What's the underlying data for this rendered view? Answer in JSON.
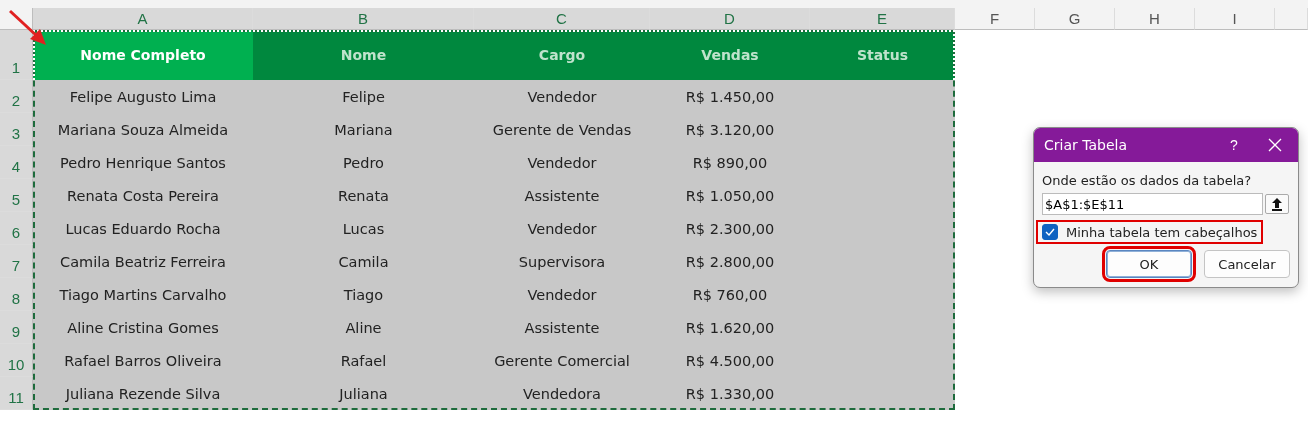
{
  "sheet": {
    "columns": [
      {
        "label": "A",
        "selected": true
      },
      {
        "label": "B",
        "selected": true
      },
      {
        "label": "C",
        "selected": true
      },
      {
        "label": "D",
        "selected": true
      },
      {
        "label": "E",
        "selected": true
      },
      {
        "label": "F",
        "selected": false
      },
      {
        "label": "G",
        "selected": false
      },
      {
        "label": "H",
        "selected": false
      },
      {
        "label": "I",
        "selected": false
      }
    ],
    "row_numbers": [
      {
        "label": "1",
        "selected": true
      },
      {
        "label": "2",
        "selected": true
      },
      {
        "label": "3",
        "selected": true
      },
      {
        "label": "4",
        "selected": true
      },
      {
        "label": "5",
        "selected": true
      },
      {
        "label": "6",
        "selected": true
      },
      {
        "label": "7",
        "selected": true
      },
      {
        "label": "8",
        "selected": true
      },
      {
        "label": "9",
        "selected": true
      },
      {
        "label": "10",
        "selected": true
      },
      {
        "label": "11",
        "selected": true
      }
    ],
    "header": [
      {
        "text": "Nome Completo",
        "selected": true
      },
      {
        "text": "Nome",
        "selected": false
      },
      {
        "text": "Cargo",
        "selected": false
      },
      {
        "text": "Vendas",
        "selected": false
      },
      {
        "text": "Status",
        "selected": false
      }
    ],
    "rows": [
      [
        "Felipe Augusto Lima",
        "Felipe",
        "Vendedor",
        "R$ 1.450,00",
        ""
      ],
      [
        "Mariana Souza Almeida",
        "Mariana",
        "Gerente de Vendas",
        "R$ 3.120,00",
        ""
      ],
      [
        "Pedro Henrique Santos",
        "Pedro",
        "Vendedor",
        "R$ 890,00",
        ""
      ],
      [
        "Renata Costa Pereira",
        "Renata",
        "Assistente",
        "R$ 1.050,00",
        ""
      ],
      [
        "Lucas Eduardo Rocha",
        "Lucas",
        "Vendedor",
        "R$ 2.300,00",
        ""
      ],
      [
        "Camila Beatriz Ferreira",
        "Camila",
        "Supervisora",
        "R$ 2.800,00",
        ""
      ],
      [
        "Tiago Martins Carvalho",
        "Tiago",
        "Vendedor",
        "R$ 760,00",
        ""
      ],
      [
        "Aline Cristina Gomes",
        "Aline",
        "Assistente",
        "R$ 1.620,00",
        ""
      ],
      [
        "Rafael Barros Oliveira",
        "Rafael",
        "Gerente Comercial",
        "R$ 4.500,00",
        ""
      ],
      [
        "Juliana Rezende Silva",
        "Juliana",
        "Vendedora",
        "R$ 1.330,00",
        ""
      ]
    ]
  },
  "dialog": {
    "title": "Criar Tabela",
    "help": "?",
    "prompt": "Onde estão os dados da tabela?",
    "range_value": "$A$1:$E$11",
    "checkbox": {
      "label": "Minha tabela tem cabeçalhos",
      "checked": true,
      "highlighted": true
    },
    "buttons": [
      {
        "label": "OK",
        "default": true,
        "highlighted": true
      },
      {
        "label": "Cancelar",
        "default": false,
        "highlighted": false
      }
    ]
  }
}
